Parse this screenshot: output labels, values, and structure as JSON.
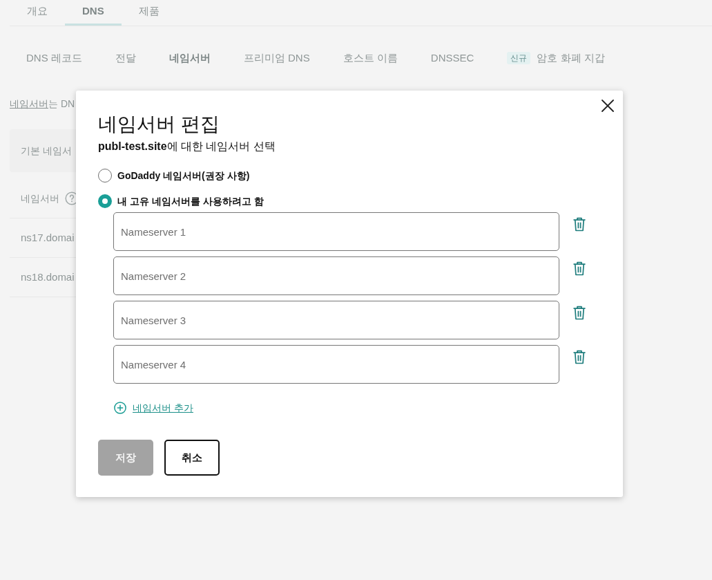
{
  "tabs": [
    {
      "label": "개요",
      "selected": false
    },
    {
      "label": "DNS",
      "selected": true
    },
    {
      "label": "제품",
      "selected": false
    }
  ],
  "subtabs": [
    {
      "label": "DNS 레코드",
      "selected": false
    },
    {
      "label": "전달",
      "selected": false
    },
    {
      "label": "네임서버",
      "selected": true
    },
    {
      "label": "프리미엄 DNS",
      "selected": false
    },
    {
      "label": "호스트 이름",
      "selected": false
    },
    {
      "label": "DNSSEC",
      "selected": false
    },
    {
      "label": "암호 화폐 지갑",
      "badge": "신규",
      "selected": false
    }
  ],
  "intro": {
    "link": "네임서버",
    "text": "는 DN"
  },
  "card": {
    "title": "기본 네임서"
  },
  "table": {
    "header": "네임서버",
    "rows": [
      "ns17.domai",
      "ns18.domai"
    ]
  },
  "dialog": {
    "title": "네임서버 편집",
    "subtitle": "**publ-test.site**에 대한 네임서버 선택",
    "options": [
      {
        "label": "GoDaddy 네임서버(권장 사항)",
        "selected": false
      },
      {
        "label": "내 고유 네임서버를 사용하려고 함",
        "selected": true
      }
    ],
    "nameserver_fields": [
      {
        "placeholder": "Nameserver 1"
      },
      {
        "placeholder": "Nameserver 2"
      },
      {
        "placeholder": "Nameserver 3"
      },
      {
        "placeholder": "Nameserver 4"
      }
    ],
    "add_link": "네임서버 추가",
    "buttons": [
      {
        "label": "저장",
        "kind": "primary",
        "disabled": true
      },
      {
        "label": "취소",
        "kind": "secondary",
        "disabled": false
      }
    ]
  }
}
